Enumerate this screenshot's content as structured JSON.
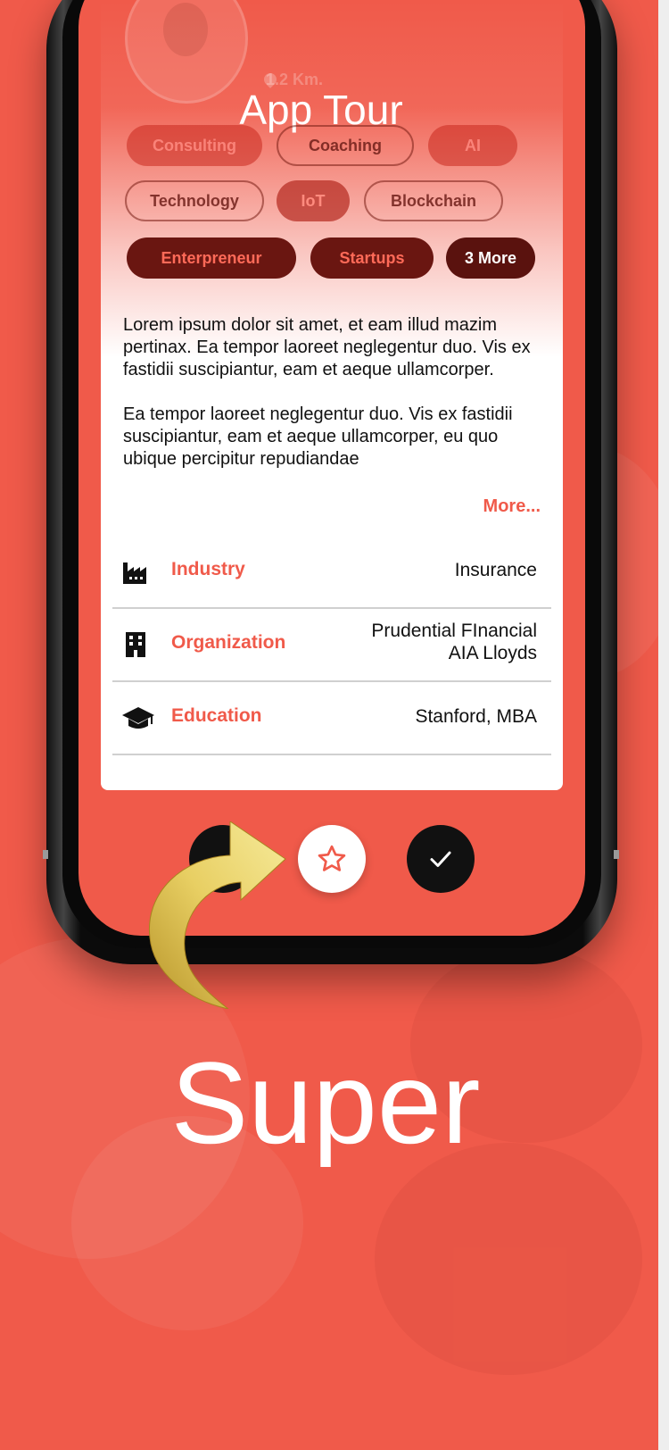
{
  "app": {
    "tour_title": "App Tour"
  },
  "profile": {
    "distance": "1.2 Km."
  },
  "tags": [
    {
      "label": "Consulting"
    },
    {
      "label": "Coaching"
    },
    {
      "label": "AI"
    },
    {
      "label": "Technology"
    },
    {
      "label": "IoT"
    },
    {
      "label": "Blockchain"
    },
    {
      "label": "Enterpreneur"
    },
    {
      "label": "Startups"
    },
    {
      "label": "3 More"
    }
  ],
  "about": {
    "paragraph_1": "Lorem ipsum dolor sit amet, et eam illud mazim pertinax. Ea tempor laoreet neglegentur duo. Vis ex fastidii suscipiantur, eam et aeque ullamcorper.",
    "paragraph_2": "Ea tempor laoreet neglegentur duo. Vis ex fastidii suscipiantur, eam et aeque ullamcorper, eu quo ubique percipitur repudiandae",
    "more_link": "More..."
  },
  "details": [
    {
      "icon": "factory-icon",
      "label": "Industry",
      "value": "Insurance"
    },
    {
      "icon": "building-icon",
      "label": "Organization",
      "value_line_1": "Prudential FInancial",
      "value_line_2": "AIA Lloyds"
    },
    {
      "icon": "graduation-cap-icon",
      "label": "Education",
      "value": "Stanford, MBA"
    }
  ],
  "actions": {
    "back_icon": "back-icon",
    "super_icon": "star-icon",
    "accept_icon": "checkmark-icon"
  },
  "caption": "Super",
  "colors": {
    "brand": "#f05a4a",
    "dark_chip": "#6a1611",
    "text": "#111111",
    "arrow_gold": "#c9a83a"
  }
}
